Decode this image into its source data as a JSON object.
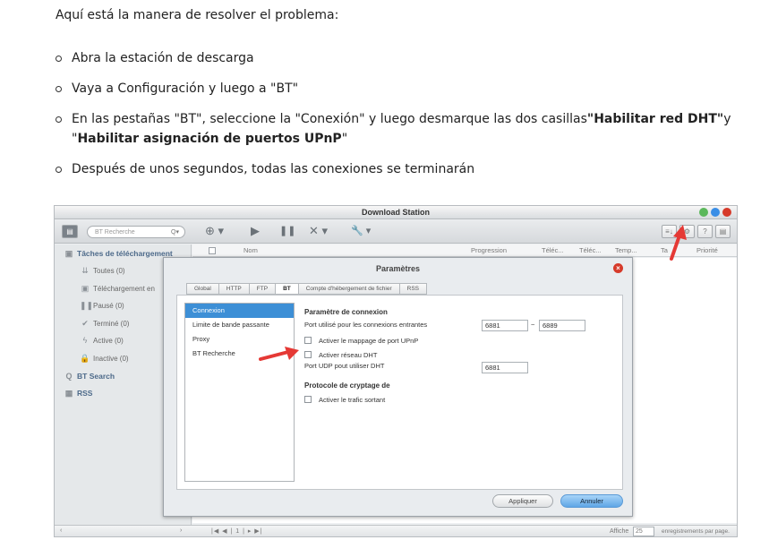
{
  "article": {
    "intro": "Aquí está la manera de resolver el problema:",
    "steps": [
      {
        "text": "Abra la estación de descarga"
      },
      {
        "text": "Vaya a Configuración y luego a \"BT\""
      },
      {
        "pre": "En las pestañas \"BT\", seleccione la \"Conexión\" y luego desmarque las dos casillas",
        "b1": "\"Habilitar red DHT\"",
        "mid": "y \"",
        "b2": "Habilitar asignación de puertos UPnP",
        "post": "\""
      },
      {
        "text": "Después de unos segundos, todas las conexiones se terminarán"
      }
    ]
  },
  "window": {
    "title": "Download Station",
    "toolbar": {
      "search_placeholder": "BT Recherche",
      "add": "⊕ ▾",
      "play": "▶",
      "pause": "❚❚",
      "delete": "✕ ▾",
      "tools": "🔧 ▾",
      "btn_sort": "≡↓",
      "btn_settings": "⚙",
      "btn_help": "?",
      "btn_list": "▤"
    },
    "sidebar": {
      "tasks": "Tâches de téléchargement",
      "items": [
        "Toutes (0)",
        "Téléchargement en",
        "Pausé (0)",
        "Terminé (0)",
        "Active (0)",
        "Inactive (0)"
      ],
      "bt_search": "BT Search",
      "rss": "RSS"
    },
    "grid_columns": [
      "Nom",
      "Progression",
      "Téléc...",
      "Téléc...",
      "Temp...",
      "Ta",
      "Priorité"
    ],
    "statusbar": {
      "pager": "|◀  ◀  |  1  |   ▸  ▶|",
      "show": "Affiche",
      "per_page": "25",
      "records": "enregistrements par page."
    }
  },
  "dialog": {
    "title": "Paramètres",
    "tabs": [
      "Global",
      "HTTP",
      "FTP",
      "BT",
      "Compte d'hébergement de fichier",
      "RSS"
    ],
    "active_tab": "BT",
    "subnav": [
      "Connexion",
      "Limite de bande passante",
      "Proxy",
      "BT Recherche"
    ],
    "active_subnav": "Connexion",
    "section1_title": "Paramètre de connexion",
    "ports_label": "Port utilisé pour les connexions entrantes",
    "port_from": "6881",
    "port_sep": "~",
    "port_to": "6889",
    "upnp_label": "Activer le mappage de port UPnP",
    "dht_label": "Activer réseau DHT",
    "udp_label": "Port UDP pout utiliser DHT",
    "udp_port": "6881",
    "section2_title": "Protocole de cryptage de",
    "outgoing_label": "Activer le trafic sortant",
    "apply": "Appliquer",
    "cancel": "Annuler"
  },
  "colors": {
    "accent": "#3d8fd6",
    "arrow": "#e53935",
    "close": "#d63a2a"
  }
}
